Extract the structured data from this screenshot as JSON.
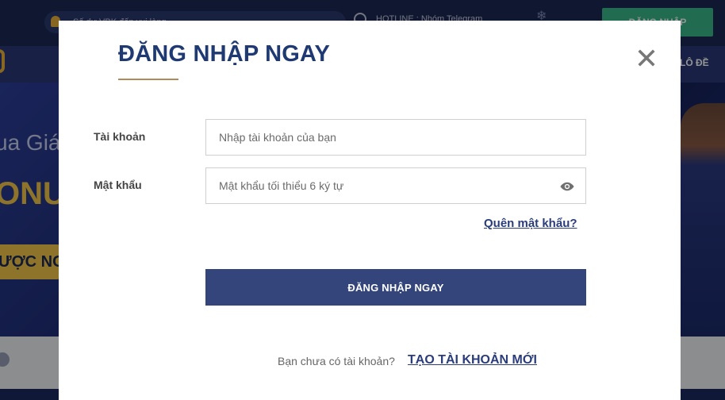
{
  "background": {
    "marquee_text": "Số dư VBK đến vui lòng...",
    "hotline_text": "HOTLINE : Nhóm Telegram",
    "login_button_label": "ĐĂNG NHẬP",
    "nav_item_label": "LÔ ĐỀ",
    "banner_line1": "ua Giá",
    "banner_line2": "ONU",
    "banner_cta_label": "ƯỢC NG"
  },
  "modal": {
    "title": "ĐĂNG NHẬP NGAY",
    "close_icon": "close-icon",
    "username": {
      "label": "Tài khoản",
      "value": "",
      "placeholder": "Nhập tài khoản của bạn"
    },
    "password": {
      "label": "Mật khẩu",
      "value": "",
      "placeholder": "Mật khẩu tối thiểu 6 ký tự",
      "toggle_icon": "eye-icon"
    },
    "forgot_password_label": "Quên mật khẩu?",
    "submit_label": "ĐĂNG NHẬP NGAY",
    "signup_prompt": "Bạn chưa có tài khoản?",
    "signup_link_label": "TẠO TÀI KHOẢN MỚI"
  },
  "colors": {
    "title": "#1f3a72",
    "accent_underline": "#b08a5a",
    "button": "#33457a",
    "link": "#2a3d7a",
    "background_login": "#39b88a"
  }
}
